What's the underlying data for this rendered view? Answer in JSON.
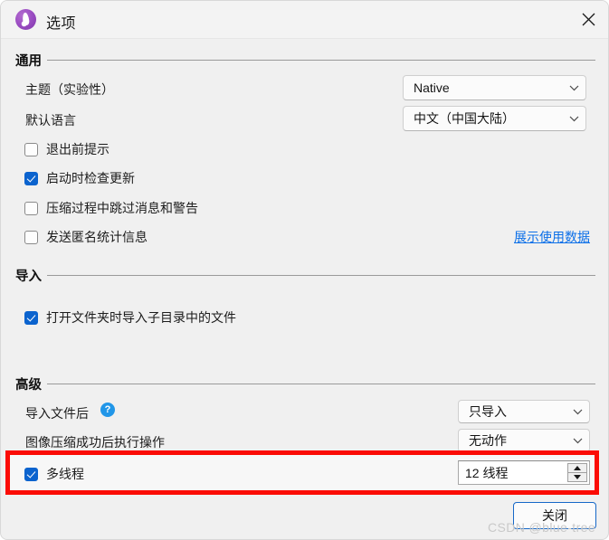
{
  "window": {
    "title": "选项",
    "app_icon": "app-flame-icon",
    "close_icon": "close-icon"
  },
  "sections": {
    "general": {
      "title": "通用",
      "theme": {
        "label": "主题（实验性）",
        "value": "Native"
      },
      "language": {
        "label": "默认语言",
        "value": "中文（中国大陆）"
      },
      "checkboxes": [
        {
          "label": "退出前提示",
          "checked": false
        },
        {
          "label": "启动时检查更新",
          "checked": true
        },
        {
          "label": "压缩过程中跳过消息和警告",
          "checked": false
        },
        {
          "label": "发送匿名统计信息",
          "checked": false
        }
      ],
      "usage_data_link": "展示使用数据"
    },
    "import": {
      "title": "导入",
      "checkboxes": [
        {
          "label": "打开文件夹时导入子目录中的文件",
          "checked": true
        }
      ]
    },
    "advanced": {
      "title": "高级",
      "after_import": {
        "label": "导入文件后",
        "help_icon": "?",
        "value": "只导入"
      },
      "after_compress": {
        "label": "图像压缩成功后执行操作",
        "value": "无动作"
      },
      "multithread": {
        "label": "多线程",
        "checked": true,
        "value": "12 线程"
      }
    }
  },
  "footer": {
    "close_button": "关闭"
  },
  "watermark": "CSDN @blue-tree",
  "colors": {
    "accent": "#0b63ce",
    "link": "#0b6fe8",
    "highlight": "#fb0c05",
    "window_bg": "#f0f0f0",
    "help": "#2196e8"
  }
}
